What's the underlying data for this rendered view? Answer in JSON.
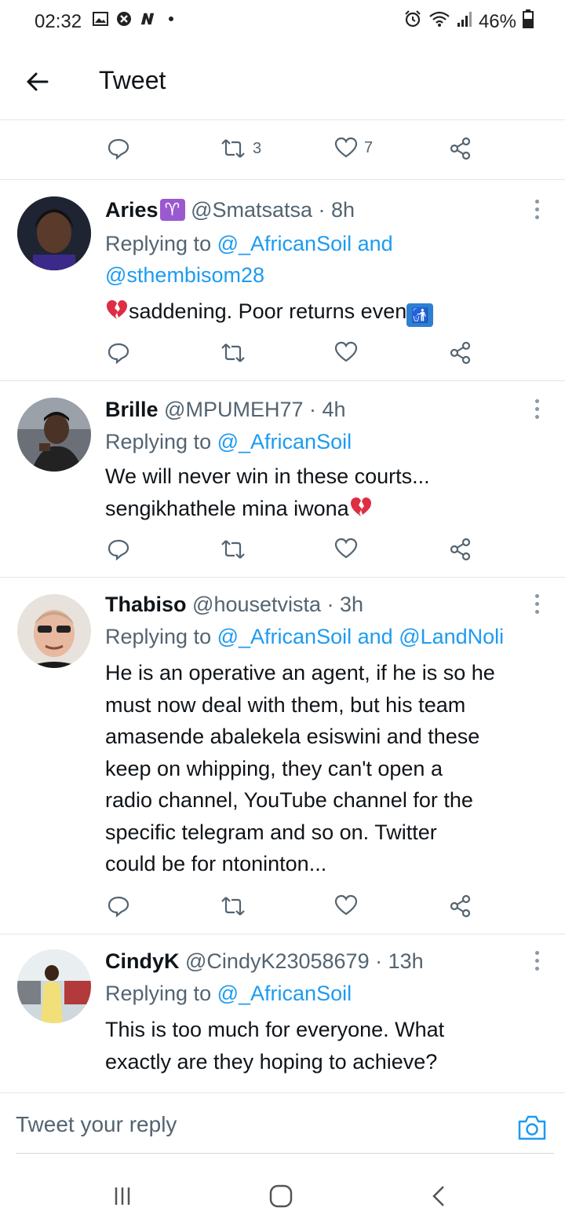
{
  "status_bar": {
    "time": "02:32",
    "battery": "46%",
    "left_icons": [
      "gallery-icon",
      "blocked-icon",
      "n-icon",
      "dot-icon"
    ],
    "right_icons": [
      "alarm-icon",
      "wifi-icon",
      "signal-icon",
      "battery-icon"
    ]
  },
  "app_bar": {
    "title": "Tweet"
  },
  "partial_actions": {
    "retweets": "3",
    "likes": "7"
  },
  "tweets": [
    {
      "name": "Aries",
      "name_emoji": "♈",
      "handle": "@Smatsatsa",
      "time": "· 8h",
      "replying_prefix": "Replying to",
      "replying_to_1": "@_AfricanSoil",
      "replying_join": "and",
      "replying_to_2": "@sthembisom28",
      "text": "saddening. Poor returns even",
      "avatar_color": "#2b2b3d"
    },
    {
      "name": "Brille",
      "handle": "@MPUMEH77",
      "time": "· 4h",
      "replying_prefix": "Replying to",
      "replying_to_1": "@_AfricanSoil",
      "text_line1": "We will never win in these courts...",
      "text_line2": "sengikhathele mina iwona",
      "avatar_color": "#3a3f45"
    },
    {
      "name": "Thabiso",
      "handle": "@housetvista",
      "time": "· 3h",
      "replying_prefix": "Replying to",
      "replying_to_1": "@_AfricanSoil",
      "replying_join": "and",
      "replying_to_2": "@LandNoli",
      "lines": [
        "He is an operative an agent, if he is so he",
        "must now deal with them, but his team",
        "amasende abalekela esiswini and these",
        "keep on whipping, they can't open a",
        "radio channel, YouTube channel for the",
        "specific telegram and so on. Twitter",
        "could be for ntoninton..."
      ],
      "avatar_color": "#c9b6a6"
    },
    {
      "name": "CindyK",
      "handle": "@CindyK23058679",
      "time": "· 13h",
      "replying_prefix": "Replying to",
      "replying_to_1": "@_AfricanSoil",
      "lines": [
        "This is too much for everyone. What",
        "exactly are they hoping  to achieve?"
      ],
      "avatar_color": "#d9d2c3"
    }
  ],
  "reply_box": {
    "placeholder": "Tweet your reply"
  },
  "colors": {
    "link": "#1d9bf0",
    "secondary": "#536471",
    "text": "#0f1419"
  }
}
